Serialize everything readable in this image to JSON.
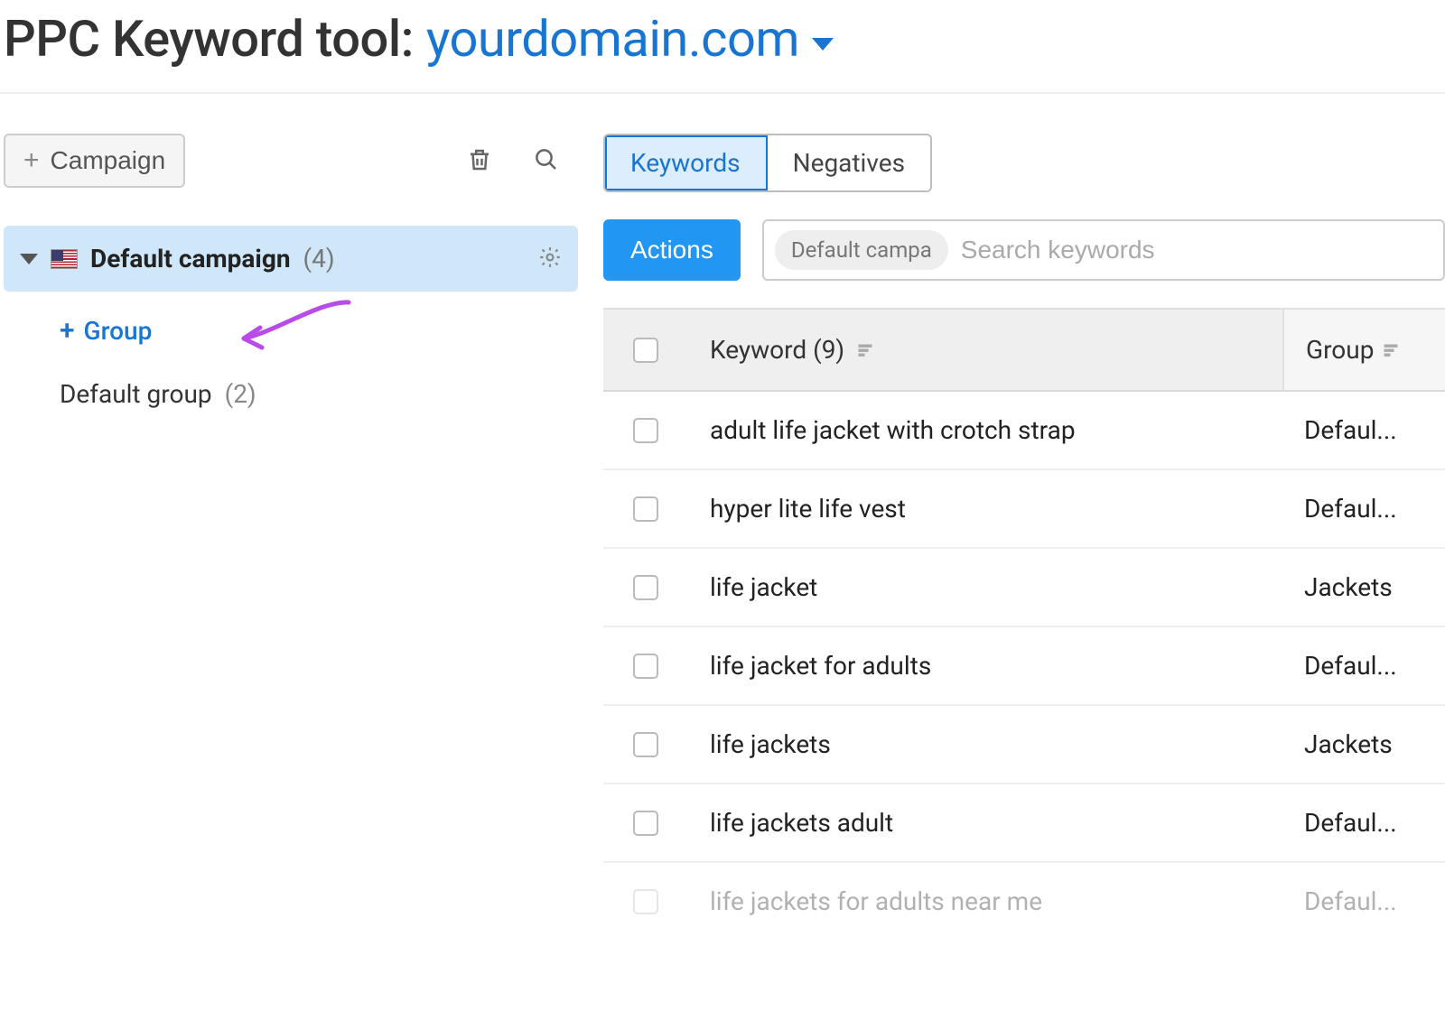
{
  "header": {
    "title_prefix": "PPC Keyword tool:",
    "domain": "yourdomain.com"
  },
  "sidebar": {
    "add_campaign_label": "Campaign",
    "campaign": {
      "name": "Default campaign",
      "count_label": "(4)"
    },
    "add_group_label": "Group",
    "groups": [
      {
        "name": "Default group",
        "count_label": "(2)"
      }
    ]
  },
  "main": {
    "tabs": {
      "keywords": "Keywords",
      "negatives": "Negatives"
    },
    "actions_label": "Actions",
    "search": {
      "chip": "Default campa",
      "placeholder": "Search keywords"
    },
    "table": {
      "header_keyword": "Keyword (9)",
      "header_group": "Group",
      "rows": [
        {
          "keyword": "adult life jacket with crotch strap",
          "group": "Defaul..."
        },
        {
          "keyword": "hyper lite life vest",
          "group": "Defaul..."
        },
        {
          "keyword": "life jacket",
          "group": "Jackets"
        },
        {
          "keyword": "life jacket for adults",
          "group": "Defaul..."
        },
        {
          "keyword": "life jackets",
          "group": "Jackets"
        },
        {
          "keyword": "life jackets adult",
          "group": "Defaul..."
        },
        {
          "keyword": "life jackets for adults near me",
          "group": "Defaul..."
        }
      ]
    }
  }
}
